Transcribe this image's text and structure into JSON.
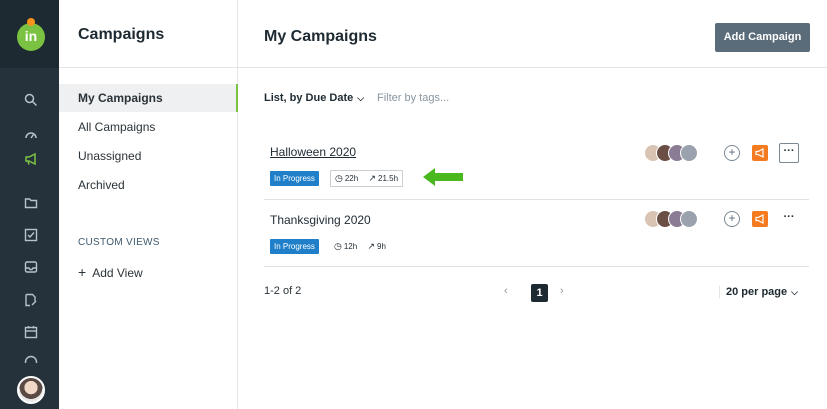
{
  "app": {
    "logo_text": "in"
  },
  "rail": {
    "icons": [
      "search-icon",
      "dashboard-icon",
      "megaphone-icon",
      "folder-icon",
      "checkbox-icon",
      "inbox-icon",
      "content-icon",
      "calendar-icon",
      "more-icon"
    ]
  },
  "sidebar": {
    "title": "Campaigns",
    "items": [
      {
        "label": "My Campaigns",
        "active": true
      },
      {
        "label": "All Campaigns",
        "active": false
      },
      {
        "label": "Unassigned",
        "active": false
      },
      {
        "label": "Archived",
        "active": false
      }
    ],
    "section_label": "CUSTOM VIEWS",
    "add_view": {
      "plus": "+",
      "label": "Add View"
    }
  },
  "main": {
    "title": "My Campaigns",
    "add_button": "Add Campaign",
    "sort_label": "List, by Due Date",
    "filter_placeholder": "Filter by tags...",
    "campaigns": [
      {
        "name": "Halloween 2020",
        "status": "In Progress",
        "time_logged": "22h",
        "time_estimated": "21.5h"
      },
      {
        "name": "Thanksgiving 2020",
        "status": "In Progress",
        "time_logged": "12h",
        "time_estimated": "9h"
      }
    ],
    "pagination": {
      "count": "1-2 of 2",
      "prev": "‹",
      "current": "1",
      "next": "›",
      "per_page": "20 per page"
    }
  },
  "colors": {
    "brand": "#7cc242",
    "status": "#1f7fc9",
    "accent": "#f47b20",
    "rail": "#26323b",
    "arrow": "#4cb81f"
  }
}
